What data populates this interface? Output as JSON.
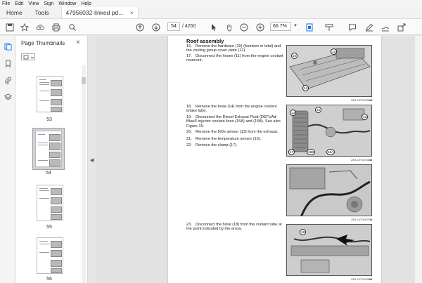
{
  "menu": [
    "File",
    "Edit",
    "View",
    "Sign",
    "Window",
    "Help"
  ],
  "tabs": {
    "home": "Home",
    "tools": "Tools",
    "document": "47956032-linked pd...",
    "close_symbol": "×"
  },
  "toolbar": {
    "page_current": "54",
    "page_total": "/ 4250",
    "zoom": "66.7%"
  },
  "thumbnails": {
    "title": "Page Thumbnails",
    "close_symbol": "×",
    "pages": [
      {
        "number": "53",
        "selected": false
      },
      {
        "number": "54",
        "selected": true
      },
      {
        "number": "55",
        "selected": false
      },
      {
        "number": "56",
        "selected": false
      }
    ]
  },
  "document": {
    "section_title": "Roof assembly",
    "steps": [
      {
        "no": "16.",
        "text": "Remove the hardware (10) (fourteen in total) and the cooling group cover plate (12)."
      },
      {
        "no": "17.",
        "text": "Disconnect the hoses (11) from the engine coolant reservoir."
      },
      {
        "no": "18.",
        "text": "Remove the hose (14) from the engine coolant intake tube."
      },
      {
        "no": "19.",
        "text": "Disconnect the Diesel Exhaust Fluid (DEF)/Ad-Blue® injector coolant lines (15A) and (15B). See also Figure 15."
      },
      {
        "no": "20.",
        "text": "Remove the NOx sensor (13) from the exhaust."
      },
      {
        "no": "21.",
        "text": "Remove the temperature sensor (16)."
      },
      {
        "no": "22.",
        "text": "Remove the clamp (17)."
      },
      {
        "no": "23.",
        "text": "Disconnect the hose (18) from the coolant tube at the point indicated by the arrow."
      }
    ],
    "figures": [
      {
        "code": "ZEIL15TD0035A",
        "number": "13"
      },
      {
        "code": "ZEIL15TD0036A",
        "number": "14"
      },
      {
        "code": "ZEIL15TD0037A",
        "number": "15"
      },
      {
        "code": "ZEIL15TD0038A",
        "number": "16"
      }
    ],
    "callouts": [
      "10",
      "11",
      "12",
      "13",
      "14",
      "16",
      "17",
      "15A",
      "15B",
      "18"
    ]
  },
  "colors": {
    "accent": "#1473e6",
    "toolbar_bg": "#fafafa",
    "canvas_bg": "#e2e2e2"
  }
}
